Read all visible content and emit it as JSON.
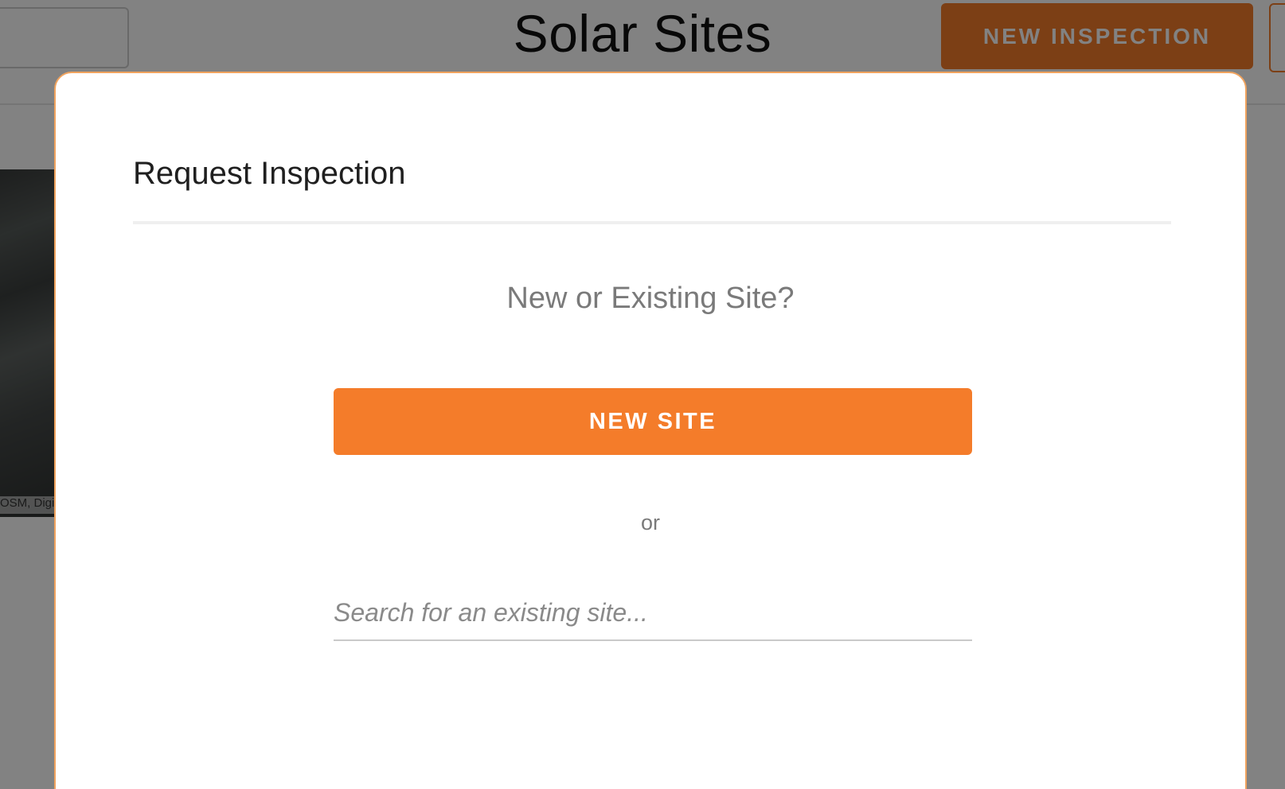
{
  "background": {
    "page_title": "Solar Sites",
    "new_inspection_label": "NEW INSPECTION",
    "map_attribution": "OSM, Digi"
  },
  "modal": {
    "title": "Request Inspection",
    "question": "New or Existing Site?",
    "new_site_label": "NEW SITE",
    "or_text": "or",
    "search_placeholder": "Search for an existing site..."
  },
  "colors": {
    "accent": "#f47c2a",
    "modal_border": "#f0a35e",
    "overlay": "rgba(0,0,0,0.49)"
  }
}
